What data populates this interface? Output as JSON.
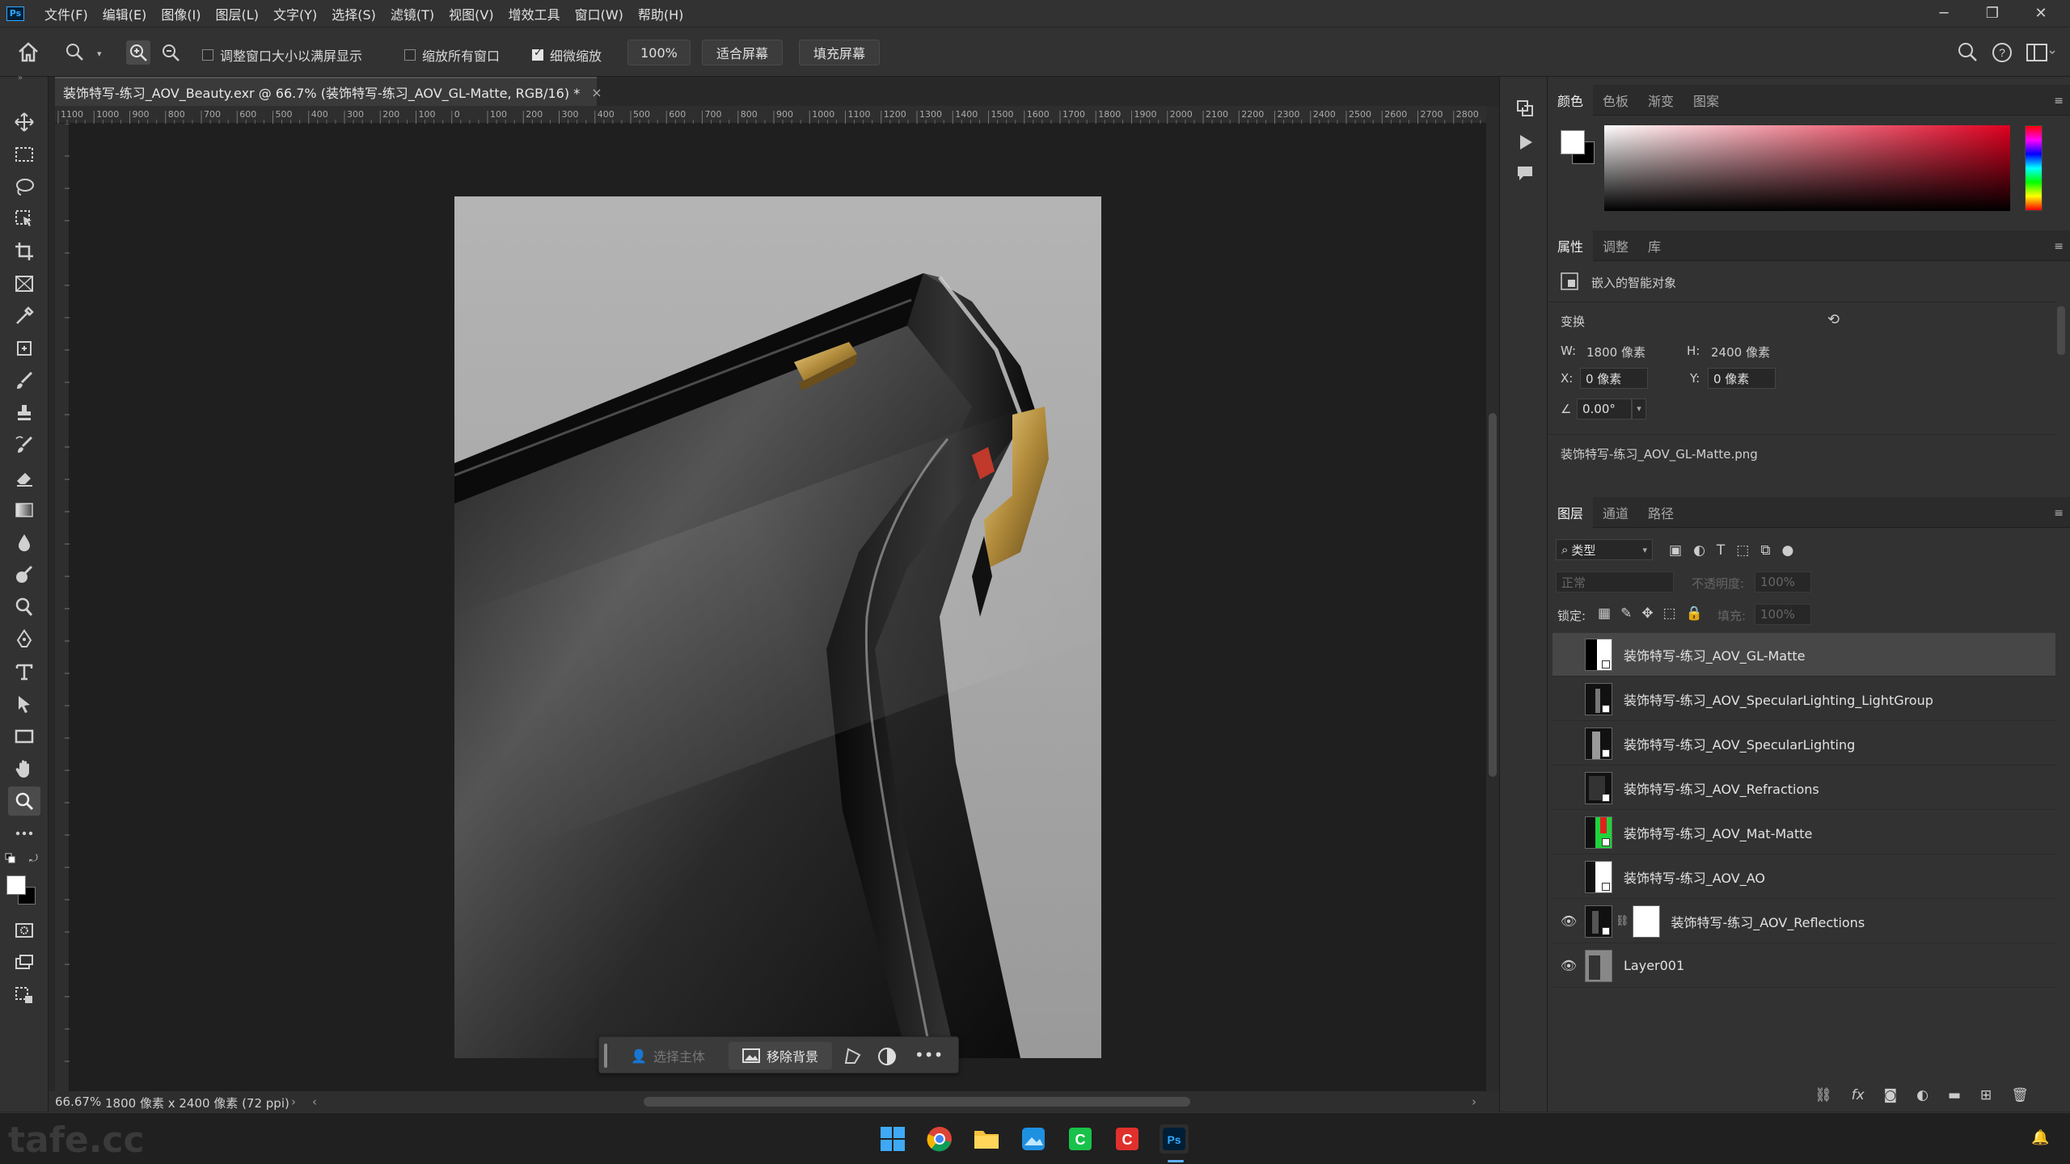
{
  "menubar": {
    "logo": "Ps",
    "items": [
      "文件(F)",
      "编辑(E)",
      "图像(I)",
      "图层(L)",
      "文字(Y)",
      "选择(S)",
      "滤镜(T)",
      "视图(V)",
      "增效工具",
      "窗口(W)",
      "帮助(H)"
    ]
  },
  "options": {
    "resize_windows_label": "调整窗口大小以满屏显示",
    "zoom_all_label": "缩放所有窗口",
    "scrubby_zoom_label": "细微缩放",
    "zoom_value": "100%",
    "fit_screen_label": "适合屏幕",
    "fill_screen_label": "填充屏幕"
  },
  "document": {
    "tab_title": "装饰特写-练习_AOV_Beauty.exr @ 66.7% (装饰特写-练习_AOV_GL-Matte, RGB/16) *",
    "close_glyph": "×"
  },
  "ruler": {
    "h_ticks": [
      "1100",
      "1000",
      "900",
      "800",
      "700",
      "600",
      "500",
      "400",
      "300",
      "200",
      "100",
      "0",
      "100",
      "200",
      "300",
      "400",
      "500",
      "600",
      "700",
      "800",
      "900",
      "1000",
      "1100",
      "1200",
      "1300",
      "1400",
      "1500",
      "1600",
      "1700",
      "1800",
      "1900",
      "2000",
      "2100",
      "2200",
      "2300",
      "2400",
      "2500",
      "2600",
      "2700",
      "2800"
    ]
  },
  "context_bar": {
    "select_subject": "选择主体",
    "remove_bg": "移除背景"
  },
  "status": {
    "zoom": "66.67%",
    "doc_info": "1800 像素 x 2400 像素 (72 ppi)"
  },
  "color_panel": {
    "tabs": [
      "颜色",
      "色板",
      "渐变",
      "图案"
    ],
    "active_tab": 0,
    "fg_color": "#ffffff",
    "bg_color": "#000000",
    "hue_color": "#e00020"
  },
  "properties": {
    "tabs": [
      "属性",
      "调整",
      "库"
    ],
    "active_tab": 0,
    "object_type": "嵌入的智能对象",
    "section": "变换",
    "w_label": "W:",
    "w_value": "1800 像素",
    "h_label": "H:",
    "h_value": "2400 像素",
    "x_label": "X:",
    "x_value": "0 像素",
    "y_label": "Y:",
    "y_value": "0 像素",
    "angle_value": "0.00°",
    "filename": "装饰特写-练习_AOV_GL-Matte.png"
  },
  "layers_panel": {
    "tabs": [
      "图层",
      "通道",
      "路径"
    ],
    "active_tab": 0,
    "filter_kind": "类型",
    "blend_mode": "正常",
    "opacity_label": "不透明度:",
    "opacity_value": "100%",
    "lock_label": "锁定:",
    "fill_label": "填充:",
    "fill_value": "100%",
    "layers": [
      {
        "name": "装饰特写-练习_AOV_GL-Matte",
        "visible": false,
        "selected": true,
        "thumb": "white"
      },
      {
        "name": "装饰特写-练习_AOV_SpecularLighting_LightGroup",
        "visible": false,
        "selected": false,
        "thumb": "dark"
      },
      {
        "name": "装饰特写-练习_AOV_SpecularLighting",
        "visible": false,
        "selected": false,
        "thumb": "dark"
      },
      {
        "name": "装饰特写-练习_AOV_Refractions",
        "visible": false,
        "selected": false,
        "thumb": "dark"
      },
      {
        "name": "装饰特写-练习_AOV_Mat-Matte",
        "visible": false,
        "selected": false,
        "thumb": "green"
      },
      {
        "name": "装饰特写-练习_AOV_AO",
        "visible": false,
        "selected": false,
        "thumb": "white"
      },
      {
        "name": "装饰特写-练习_AOV_Reflections",
        "visible": true,
        "selected": false,
        "thumb": "dark",
        "mask": true
      },
      {
        "name": "Layer001",
        "visible": true,
        "selected": false,
        "thumb": "gray"
      }
    ]
  },
  "watermark": "tafe.cc"
}
